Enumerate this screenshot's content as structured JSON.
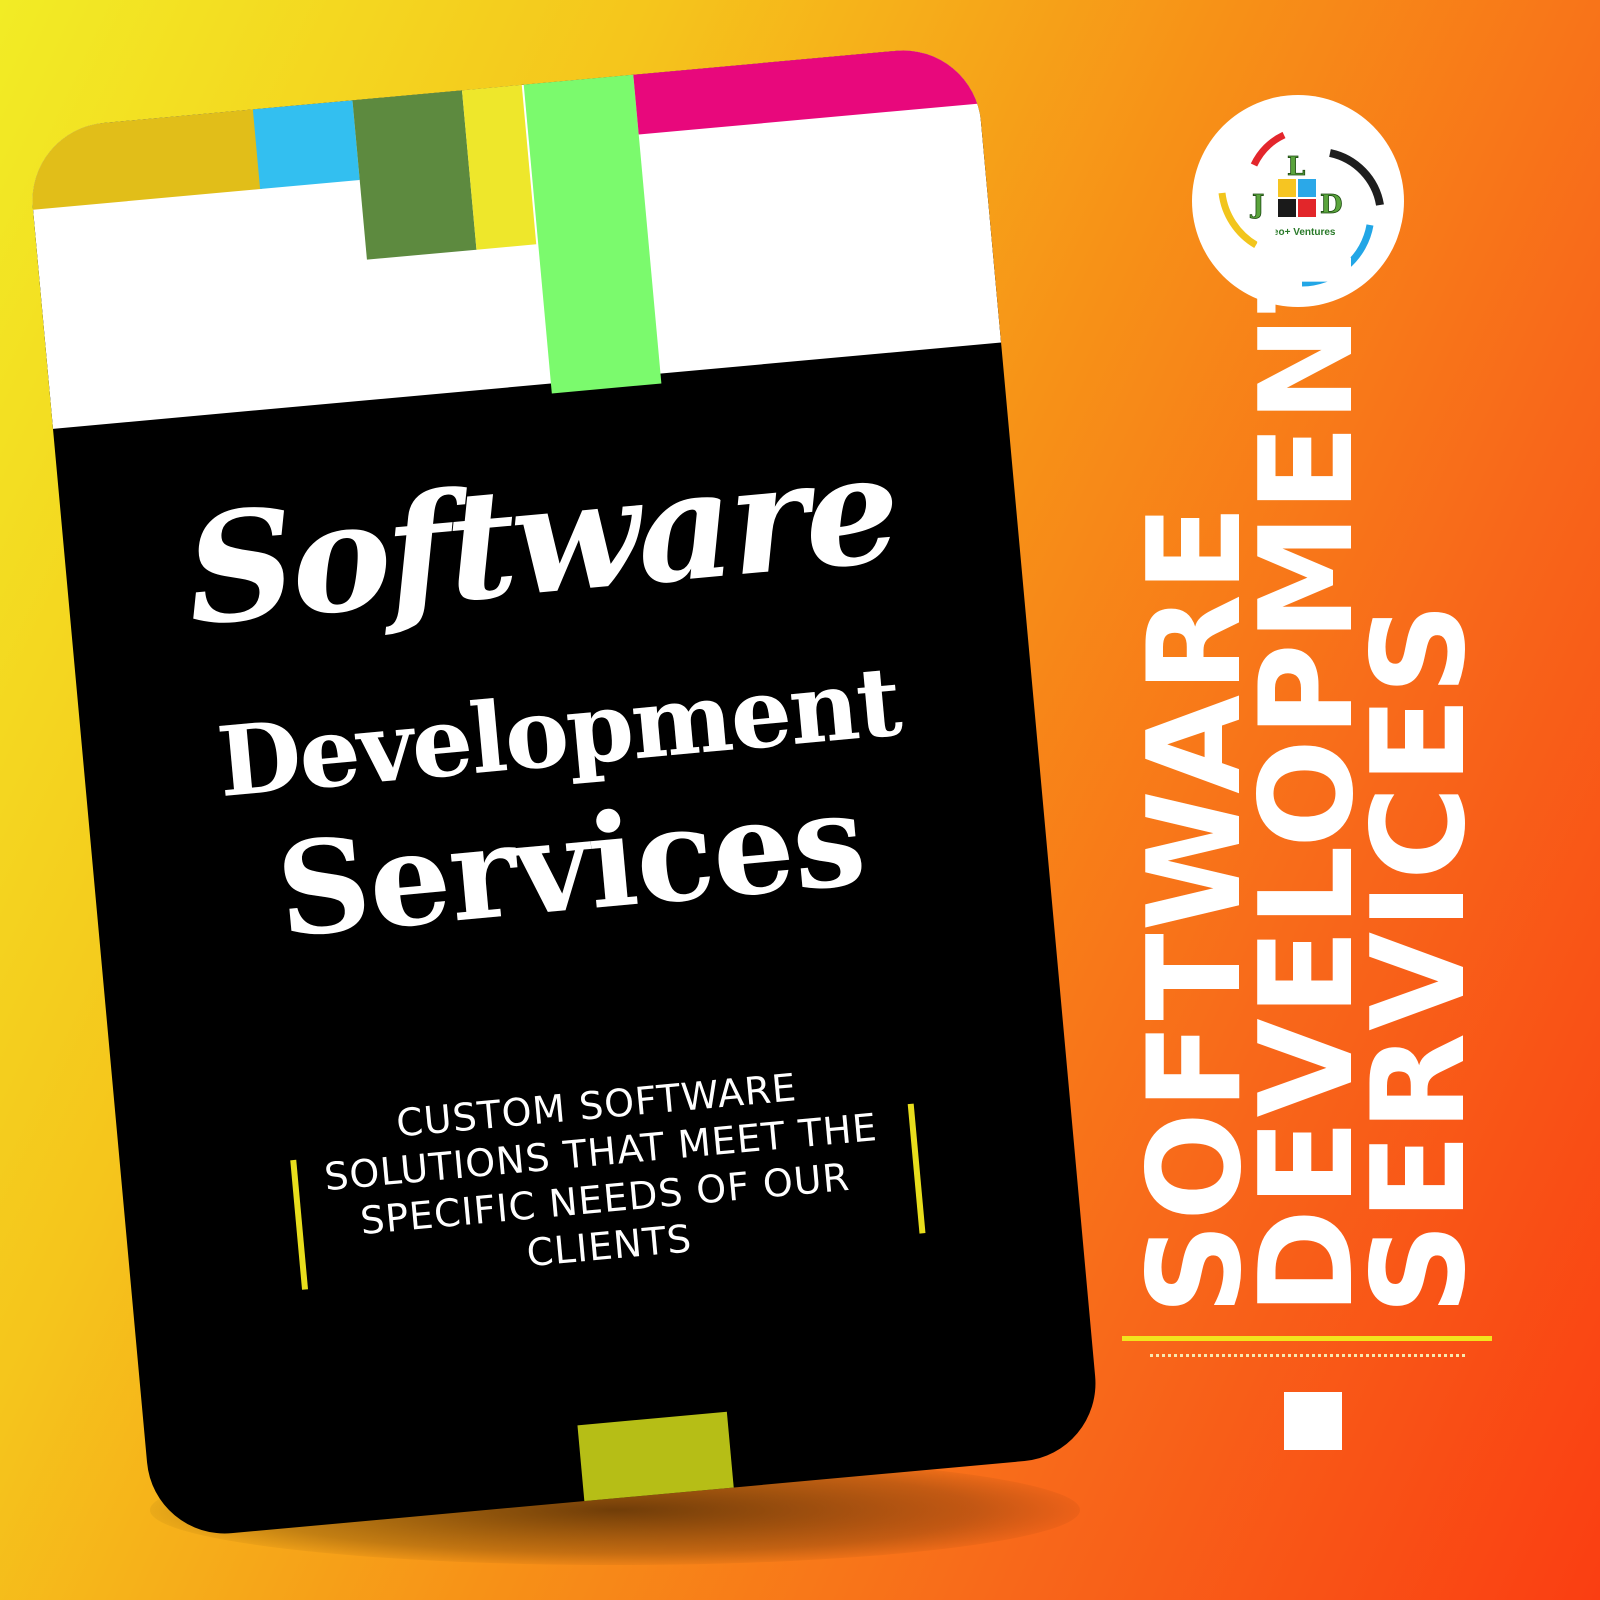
{
  "card": {
    "script_title": "Software",
    "title_line2": "Development",
    "title_line3": "Services",
    "tagline": "CUSTOM SOFTWARE SOLUTIONS THAT MEET THE SPECIFIC NEEDS OF OUR CLIENTS"
  },
  "logo": {
    "letters": [
      "L",
      "J",
      "D"
    ],
    "caption": "Aveo+ Ventures"
  },
  "side_heading": {
    "lines": [
      "SOFTWARE",
      "DEVELOPMENT",
      "SERVICES"
    ]
  },
  "colors": {
    "background_start": "#f2ec25",
    "background_end": "#fa3e12",
    "card": "#000000",
    "accent_blue": "#33bff0",
    "accent_green": "#5d8a3f",
    "accent_lime": "#7bfa6d",
    "accent_pink": "#e8087c",
    "accent_yellow": "#eee72b"
  }
}
